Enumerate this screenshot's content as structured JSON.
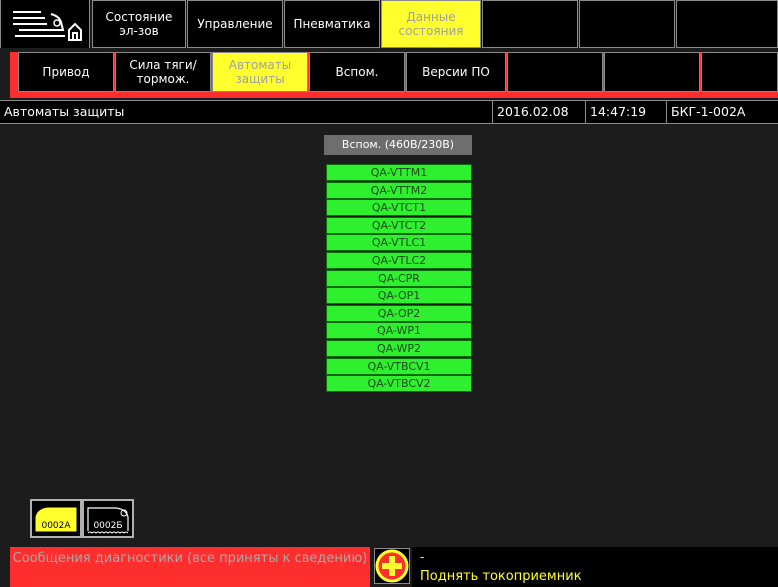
{
  "colors": {
    "accent_yellow": "#ffff2e",
    "alarm_red": "#ff2e2e",
    "breaker_green": "#2ef02e",
    "panel_gray": "#6e6e6e"
  },
  "top_menu": [
    {
      "label": "Состояние\nэл-зов",
      "active": false
    },
    {
      "label": "Управление",
      "active": false
    },
    {
      "label": "Пневматика",
      "active": false
    },
    {
      "label": "Данные\nсостояния",
      "active": true
    }
  ],
  "sub_tabs": [
    {
      "label": "Привод",
      "active": false
    },
    {
      "label": "Сила тяги/\nтормож.",
      "active": false
    },
    {
      "label": "Автоматы\nзащиты",
      "active": true
    },
    {
      "label": "Вспом.",
      "active": false
    },
    {
      "label": "Версии ПО",
      "active": false
    }
  ],
  "status": {
    "page_title": "Автоматы защиты",
    "date": "2016.02.08",
    "time": "14:47:19",
    "unit": "БКГ-1-002А"
  },
  "panel": {
    "title": "Вспом. (460В/230В)",
    "breakers": [
      {
        "label": "QA-VTTM1",
        "state": "on"
      },
      {
        "label": "QA-VTTM2",
        "state": "on"
      },
      {
        "label": "QA-VTCT1",
        "state": "on"
      },
      {
        "label": "QA-VTCT2",
        "state": "on"
      },
      {
        "label": "QA-VTLC1",
        "state": "on"
      },
      {
        "label": "QA-VTLC2",
        "state": "on"
      },
      {
        "label": "QA-CPR",
        "state": "on"
      },
      {
        "label": "QA-OP1",
        "state": "on"
      },
      {
        "label": "QA-OP2",
        "state": "on"
      },
      {
        "label": "QA-WP1",
        "state": "on"
      },
      {
        "label": "QA-WP2",
        "state": "on"
      },
      {
        "label": "QA-VTBCV1",
        "state": "on"
      },
      {
        "label": "QA-VTBCV2",
        "state": "on"
      }
    ]
  },
  "trains": [
    {
      "label": "0002А",
      "selected": true
    },
    {
      "label": "0002Б",
      "selected": false
    }
  ],
  "diagnostics": {
    "summary": "Сообщения диагностики (все приняты к сведению)",
    "code": "-",
    "message": "Поднять токоприемник"
  }
}
